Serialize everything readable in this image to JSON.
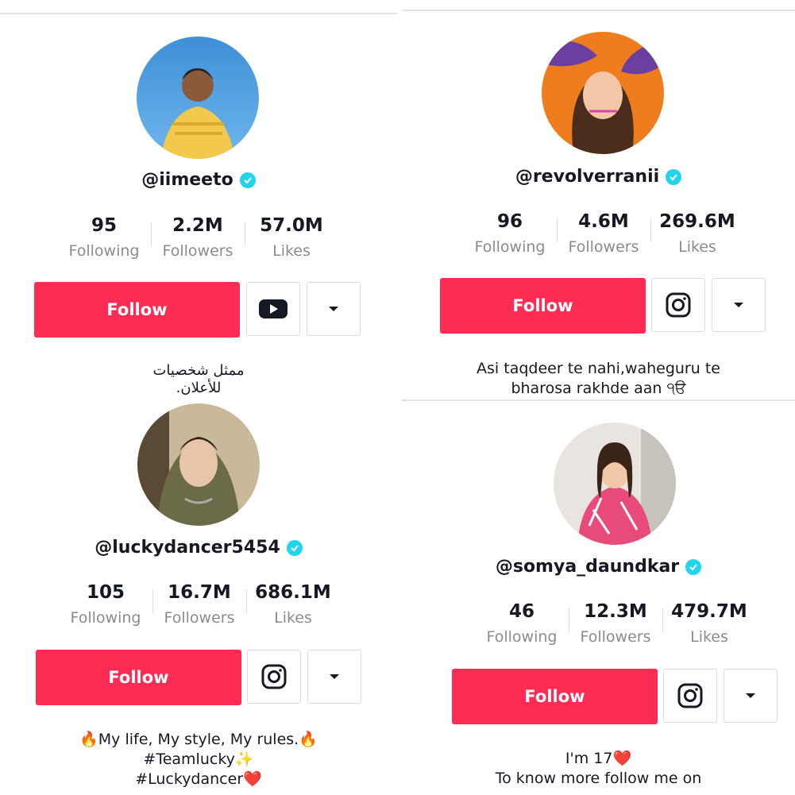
{
  "profiles": [
    {
      "username": "@iimeeto",
      "stats": [
        {
          "value": "95",
          "label": "Following"
        },
        {
          "value": "2.2M",
          "label": "Followers"
        },
        {
          "value": "57.0M",
          "label": "Likes"
        }
      ],
      "follow_label": "Follow",
      "link_icon": "youtube-icon",
      "bio_lines": [
        "ممثل شخصيات",
        "للأعلان."
      ]
    },
    {
      "username": "@revolverranii",
      "stats": [
        {
          "value": "96",
          "label": "Following"
        },
        {
          "value": "4.6M",
          "label": "Followers"
        },
        {
          "value": "269.6M",
          "label": "Likes"
        }
      ],
      "follow_label": "Follow",
      "link_icon": "instagram-icon",
      "bio_lines": [
        "Asi taqdeer te nahi,waheguru te",
        "bharosa rakhde aan ੧ੳ"
      ]
    },
    {
      "username": "@luckydancer5454",
      "stats": [
        {
          "value": "105",
          "label": "Following"
        },
        {
          "value": "16.7M",
          "label": "Followers"
        },
        {
          "value": "686.1M",
          "label": "Likes"
        }
      ],
      "follow_label": "Follow",
      "link_icon": "instagram-icon",
      "bio_lines": [
        "🔥My life, My style, My rules.🔥",
        "#Teamlucky✨",
        "#Luckydancer❤️"
      ]
    },
    {
      "username": "@somya_daundkar",
      "stats": [
        {
          "value": "46",
          "label": "Following"
        },
        {
          "value": "12.3M",
          "label": "Followers"
        },
        {
          "value": "479.7M",
          "label": "Likes"
        }
      ],
      "follow_label": "Follow",
      "link_icon": "instagram-icon",
      "bio_lines": [
        "I'm 17❤️",
        "To know more follow me on"
      ]
    }
  ],
  "colors": {
    "follow_button": "#fe2c55",
    "verified_badge": "#20d5ec",
    "label_gray": "#8a8b91"
  }
}
